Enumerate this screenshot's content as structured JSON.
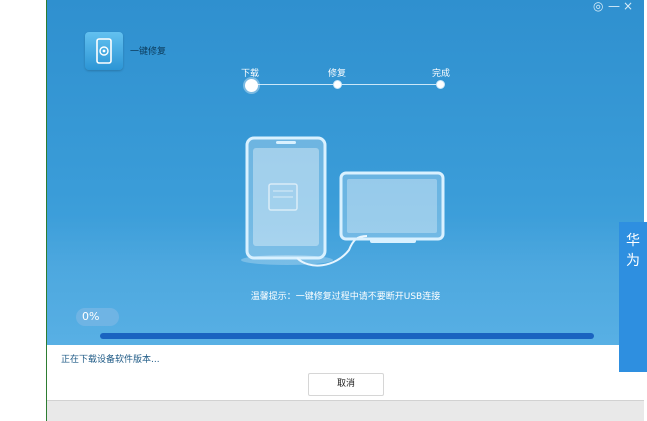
{
  "window": {
    "controls": [
      "◎",
      "—",
      "×"
    ]
  },
  "header": {
    "title": "一键修复"
  },
  "steps": [
    {
      "label": "下载",
      "state": "active"
    },
    {
      "label": "修复",
      "state": "pending"
    },
    {
      "label": "完成",
      "state": "pending"
    }
  ],
  "tip": "温馨提示：一键修复过程中请不要断开USB连接",
  "progress": {
    "percent_label": "0%",
    "value": 0
  },
  "status_text": "正在下载设备软件版本...",
  "buttons": {
    "cancel": "取消"
  },
  "side_panel": {
    "text": "华为"
  },
  "colors": {
    "hero": "#2f90cf",
    "progress_track": "#1a63c0",
    "side_panel": "#2e8fe0"
  },
  "icons": {
    "title": "phone-gear-icon",
    "illustration": "phone-to-computer-icon"
  }
}
